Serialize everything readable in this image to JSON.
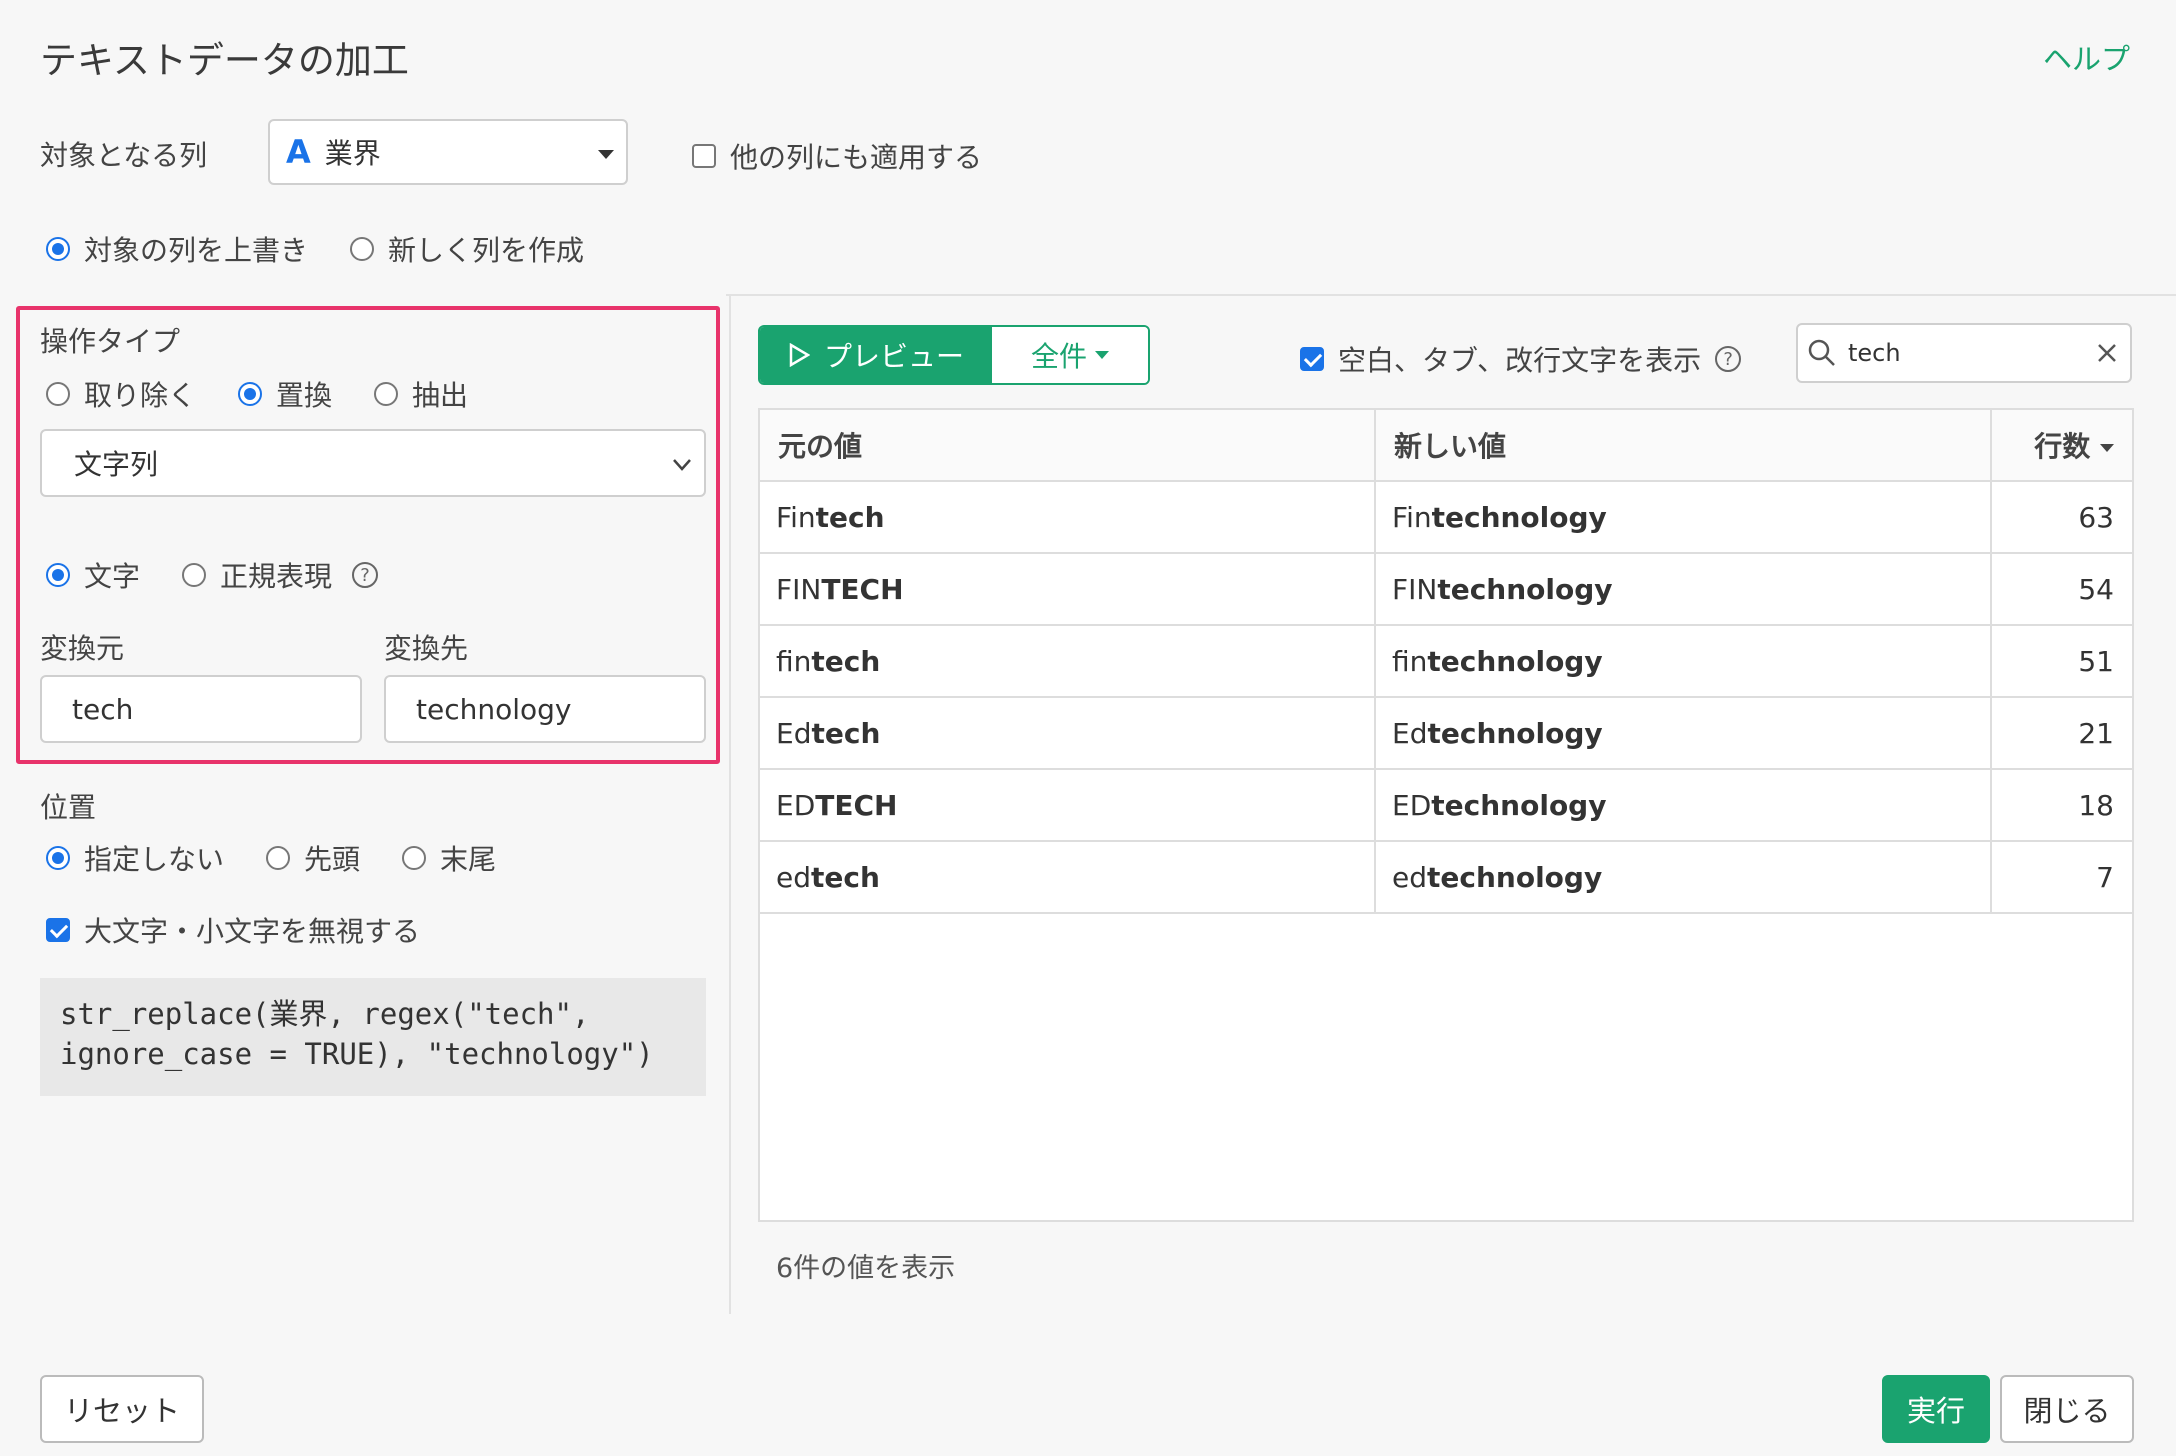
{
  "title": "テキストデータの加工",
  "help": "ヘルプ",
  "target": {
    "label": "対象となる列",
    "column_type_icon": "A",
    "column_value": "業界",
    "apply_other_label": "他の列にも適用する",
    "apply_other_checked": false
  },
  "output_mode": {
    "overwrite_label": "対象の列を上書き",
    "new_column_label": "新しく列を作成",
    "selected": "overwrite"
  },
  "operation": {
    "label": "操作タイプ",
    "options": [
      "取り除く",
      "置換",
      "抽出"
    ],
    "selected": "置換",
    "type_select_value": "文字列",
    "match_char_label": "文字",
    "match_regex_label": "正規表現",
    "match_selected": "文字",
    "from_label": "変換元",
    "from_value": "tech",
    "to_label": "変換先",
    "to_value": "technology"
  },
  "position": {
    "label": "位置",
    "options": [
      "指定しない",
      "先頭",
      "末尾"
    ],
    "selected": "指定しない"
  },
  "ignore_case": {
    "label": "大文字・小文字を無視する",
    "checked": true
  },
  "code_line1": "str_replace(業界, regex(\"tech\",",
  "code_line2": "ignore_case = TRUE), \"technology\")",
  "preview": {
    "preview_button": "プレビュー",
    "all_button": "全件",
    "show_whitespace_label": "空白、タブ、改行文字を表示",
    "show_whitespace_checked": true,
    "search_value": "tech"
  },
  "table": {
    "headers": [
      "元の値",
      "新しい値",
      "行数"
    ],
    "rows": [
      {
        "orig_pre": "Fin",
        "orig_hl": "tech",
        "new_pre": "Fin",
        "new_hl": "technology",
        "count": "63"
      },
      {
        "orig_pre": "FIN",
        "orig_hl": "TECH",
        "new_pre": "FIN",
        "new_hl": "technology",
        "count": "54"
      },
      {
        "orig_pre": "fin",
        "orig_hl": "tech",
        "new_pre": "fin",
        "new_hl": "technology",
        "count": "51"
      },
      {
        "orig_pre": "Ed",
        "orig_hl": "tech",
        "new_pre": "Ed",
        "new_hl": "technology",
        "count": "21"
      },
      {
        "orig_pre": "ED",
        "orig_hl": "TECH",
        "new_pre": "ED",
        "new_hl": "technology",
        "count": "18"
      },
      {
        "orig_pre": "ed",
        "orig_hl": "tech",
        "new_pre": "ed",
        "new_hl": "technology",
        "count": "7"
      }
    ],
    "footer": "6件の値を表示"
  },
  "buttons": {
    "reset": "リセット",
    "run": "実行",
    "close": "閉じる"
  },
  "colors": {
    "accent_green": "#1aa36f",
    "highlight_pink": "#e8336b",
    "radio_blue": "#1a73e8"
  }
}
